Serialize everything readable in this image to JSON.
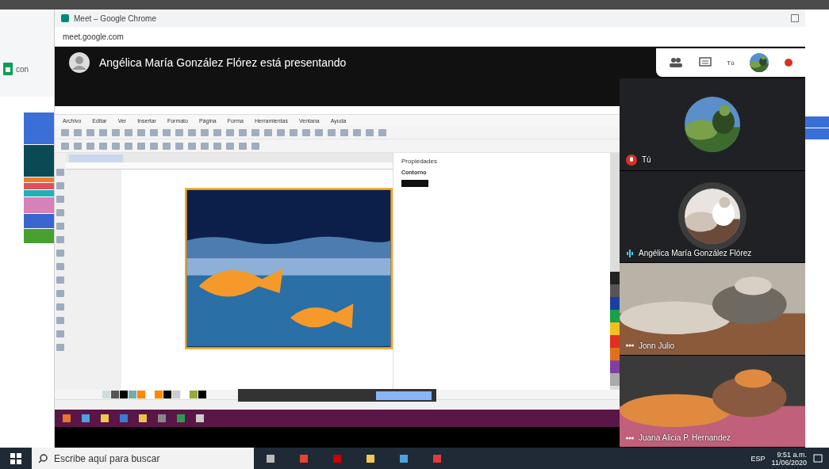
{
  "browser": {
    "title": "Meet – Google Chrome",
    "url": "meet.google.com"
  },
  "sheets": {
    "file_label": "con"
  },
  "presenter_banner": "Angélica María González Flórez está presentando",
  "top_bar": {
    "self_label": "Tú",
    "notification": true
  },
  "shared_app": {
    "menu": [
      "Archivo",
      "Editar",
      "Ver",
      "Insertar",
      "Formato",
      "Página",
      "Forma",
      "Herramientas",
      "Ventana",
      "Ayuda"
    ],
    "properties": {
      "title": "Propiedades",
      "section": "Contorno"
    }
  },
  "participants": [
    {
      "name": "Tú",
      "kind": "avatar",
      "muted": true,
      "speaking": false
    },
    {
      "name": "Angélica María González Flórez",
      "kind": "avatar",
      "muted": false,
      "speaking": true
    },
    {
      "name": "Jonn Julio",
      "kind": "video",
      "muted": false,
      "speaking": false
    },
    {
      "name": "Juana Alicia P. Hernandez",
      "kind": "video",
      "muted": false,
      "speaking": false
    }
  ],
  "taskbar": {
    "search_placeholder": "Escribe aquí para buscar",
    "language": "ESP",
    "time": "9:51 a.m.",
    "date": "11/06/2020"
  }
}
